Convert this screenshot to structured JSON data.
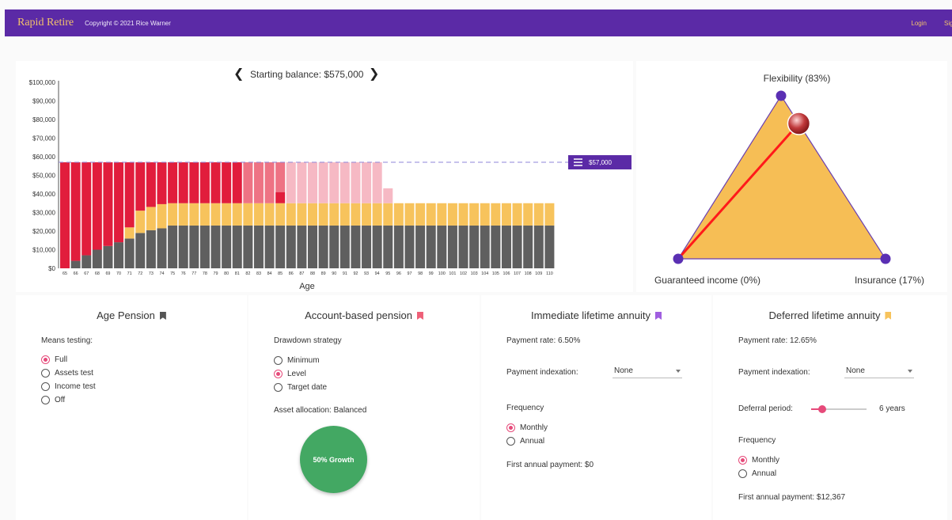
{
  "header": {
    "brand": "Rapid Retire",
    "copyright": "Copyright © 2021 Rice Warner",
    "login": "Login",
    "signup": "Sign"
  },
  "chart": {
    "balance_label": "Starting balance: $575,000",
    "badge": "$57,000",
    "xlabel": "Age",
    "colors": {
      "pension": "#5f5f5f",
      "annuity": "#f7c35c",
      "abp_dark": "#e11d3c",
      "abp_mid": "#ee7384",
      "abp_light": "#f6b9c4"
    }
  },
  "chart_data": {
    "type": "bar",
    "stacked": true,
    "title": "Starting balance: $575,000",
    "xlabel": "Age",
    "ylabel": "",
    "ylim": [
      0,
      100000
    ],
    "yticks": [
      "$0",
      "$10,000",
      "$20,000",
      "$30,000",
      "$40,000",
      "$50,000",
      "$60,000",
      "$70,000",
      "$80,000",
      "$90,000",
      "$100,000"
    ],
    "categories": [
      "65",
      "66",
      "67",
      "68",
      "69",
      "70",
      "71",
      "72",
      "73",
      "74",
      "75",
      "76",
      "77",
      "78",
      "79",
      "80",
      "81",
      "82",
      "83",
      "84",
      "85",
      "86",
      "87",
      "88",
      "89",
      "90",
      "91",
      "92",
      "93",
      "94",
      "95",
      "96",
      "97",
      "98",
      "99",
      "100",
      "101",
      "102",
      "103",
      "104",
      "105",
      "106",
      "107",
      "108",
      "109",
      "110"
    ],
    "reference_line": 57000,
    "series": [
      {
        "values": [
          0,
          4000,
          7000,
          10000,
          12000,
          14000,
          16000,
          19000,
          20500,
          21500,
          23000,
          23000,
          23000,
          23000,
          23000,
          23000,
          23000,
          23000,
          23000,
          23000,
          23000,
          23000,
          23000,
          23000,
          23000,
          23000,
          23000,
          23000,
          23000,
          23000,
          23000,
          23000,
          23000,
          23000,
          23000,
          23000,
          23000,
          23000,
          23000,
          23000,
          23000,
          23000,
          23000,
          23000,
          23000,
          23000
        ]
      },
      {
        "values": [
          0,
          0,
          0,
          0,
          0,
          0,
          6000,
          12000,
          12500,
          13000,
          12000,
          12000,
          12000,
          12000,
          12000,
          12000,
          12000,
          12000,
          12000,
          12000,
          12000,
          12000,
          12000,
          12000,
          12000,
          12000,
          12000,
          12000,
          12000,
          12000,
          12000,
          12000,
          12000,
          12000,
          12000,
          12000,
          12000,
          12000,
          12000,
          12000,
          12000,
          12000,
          12000,
          12000,
          12000,
          12000
        ]
      },
      {
        "values": [
          57000,
          53000,
          50000,
          47000,
          45000,
          43000,
          35000,
          26000,
          24000,
          22500,
          22000,
          22000,
          22000,
          22000,
          22000,
          22000,
          22000,
          0,
          0,
          0,
          6000,
          0,
          0,
          0,
          0,
          0,
          0,
          0,
          0,
          0,
          0,
          0,
          0,
          0,
          0,
          0,
          0,
          0,
          0,
          0,
          0,
          0,
          0,
          0,
          0,
          0
        ]
      },
      {
        "values": [
          0,
          0,
          0,
          0,
          0,
          0,
          0,
          0,
          0,
          0,
          0,
          0,
          0,
          0,
          0,
          0,
          0,
          22000,
          22000,
          22000,
          16000,
          0,
          0,
          0,
          0,
          0,
          0,
          0,
          0,
          0,
          0,
          0,
          0,
          0,
          0,
          0,
          0,
          0,
          0,
          0,
          0,
          0,
          0,
          0,
          0,
          0
        ]
      },
      {
        "values": [
          0,
          0,
          0,
          0,
          0,
          0,
          0,
          0,
          0,
          0,
          0,
          0,
          0,
          0,
          0,
          0,
          0,
          0,
          0,
          0,
          0,
          22000,
          22000,
          22000,
          22000,
          22000,
          22000,
          22000,
          22000,
          22000,
          8000,
          0,
          0,
          0,
          0,
          0,
          0,
          0,
          0,
          0,
          0,
          0,
          0,
          0,
          0,
          0
        ]
      }
    ]
  },
  "triangle": {
    "top_label": "Flexibility (83%)",
    "left_label": "Guaranteed income (0%)",
    "right_label": "Insurance (17%)",
    "flexibility": 0.83,
    "guaranteed": 0.0,
    "insurance": 0.17,
    "fill": "#f6be55",
    "line": "#ff1a1a",
    "vertex": "#5a2fb3"
  },
  "age_pension": {
    "title": "Age Pension",
    "bookmark_color": "#555555",
    "means_label": "Means testing:",
    "options": [
      "Full",
      "Assets test",
      "Income test",
      "Off"
    ],
    "selected": "Full"
  },
  "abp": {
    "title": "Account-based pension",
    "bookmark_color": "#ee6078",
    "strategy_label": "Drawdown strategy",
    "options": [
      "Minimum",
      "Level",
      "Target date"
    ],
    "selected": "Level",
    "allocation_label": "Asset allocation: Balanced",
    "growth_label": "50% Growth",
    "growth_color": "#43a863"
  },
  "ila": {
    "title": "Immediate lifetime annuity",
    "bookmark_color": "#a05ee0",
    "rate": "Payment rate: 6.50%",
    "indexation_label": "Payment indexation:",
    "indexation_value": "None",
    "frequency_label": "Frequency",
    "options": [
      "Monthly",
      "Annual"
    ],
    "selected": "Monthly",
    "first_payment": "First annual payment: $0"
  },
  "dla": {
    "title": "Deferred lifetime annuity",
    "bookmark_color": "#f7c35c",
    "rate": "Payment rate: 12.65%",
    "indexation_label": "Payment indexation:",
    "indexation_value": "None",
    "deferral_label": "Deferral period:",
    "deferral_value": "6 years",
    "deferral_fraction": 0.2,
    "frequency_label": "Frequency",
    "options": [
      "Monthly",
      "Annual"
    ],
    "selected": "Monthly",
    "first_payment": "First annual payment: $12,367"
  }
}
